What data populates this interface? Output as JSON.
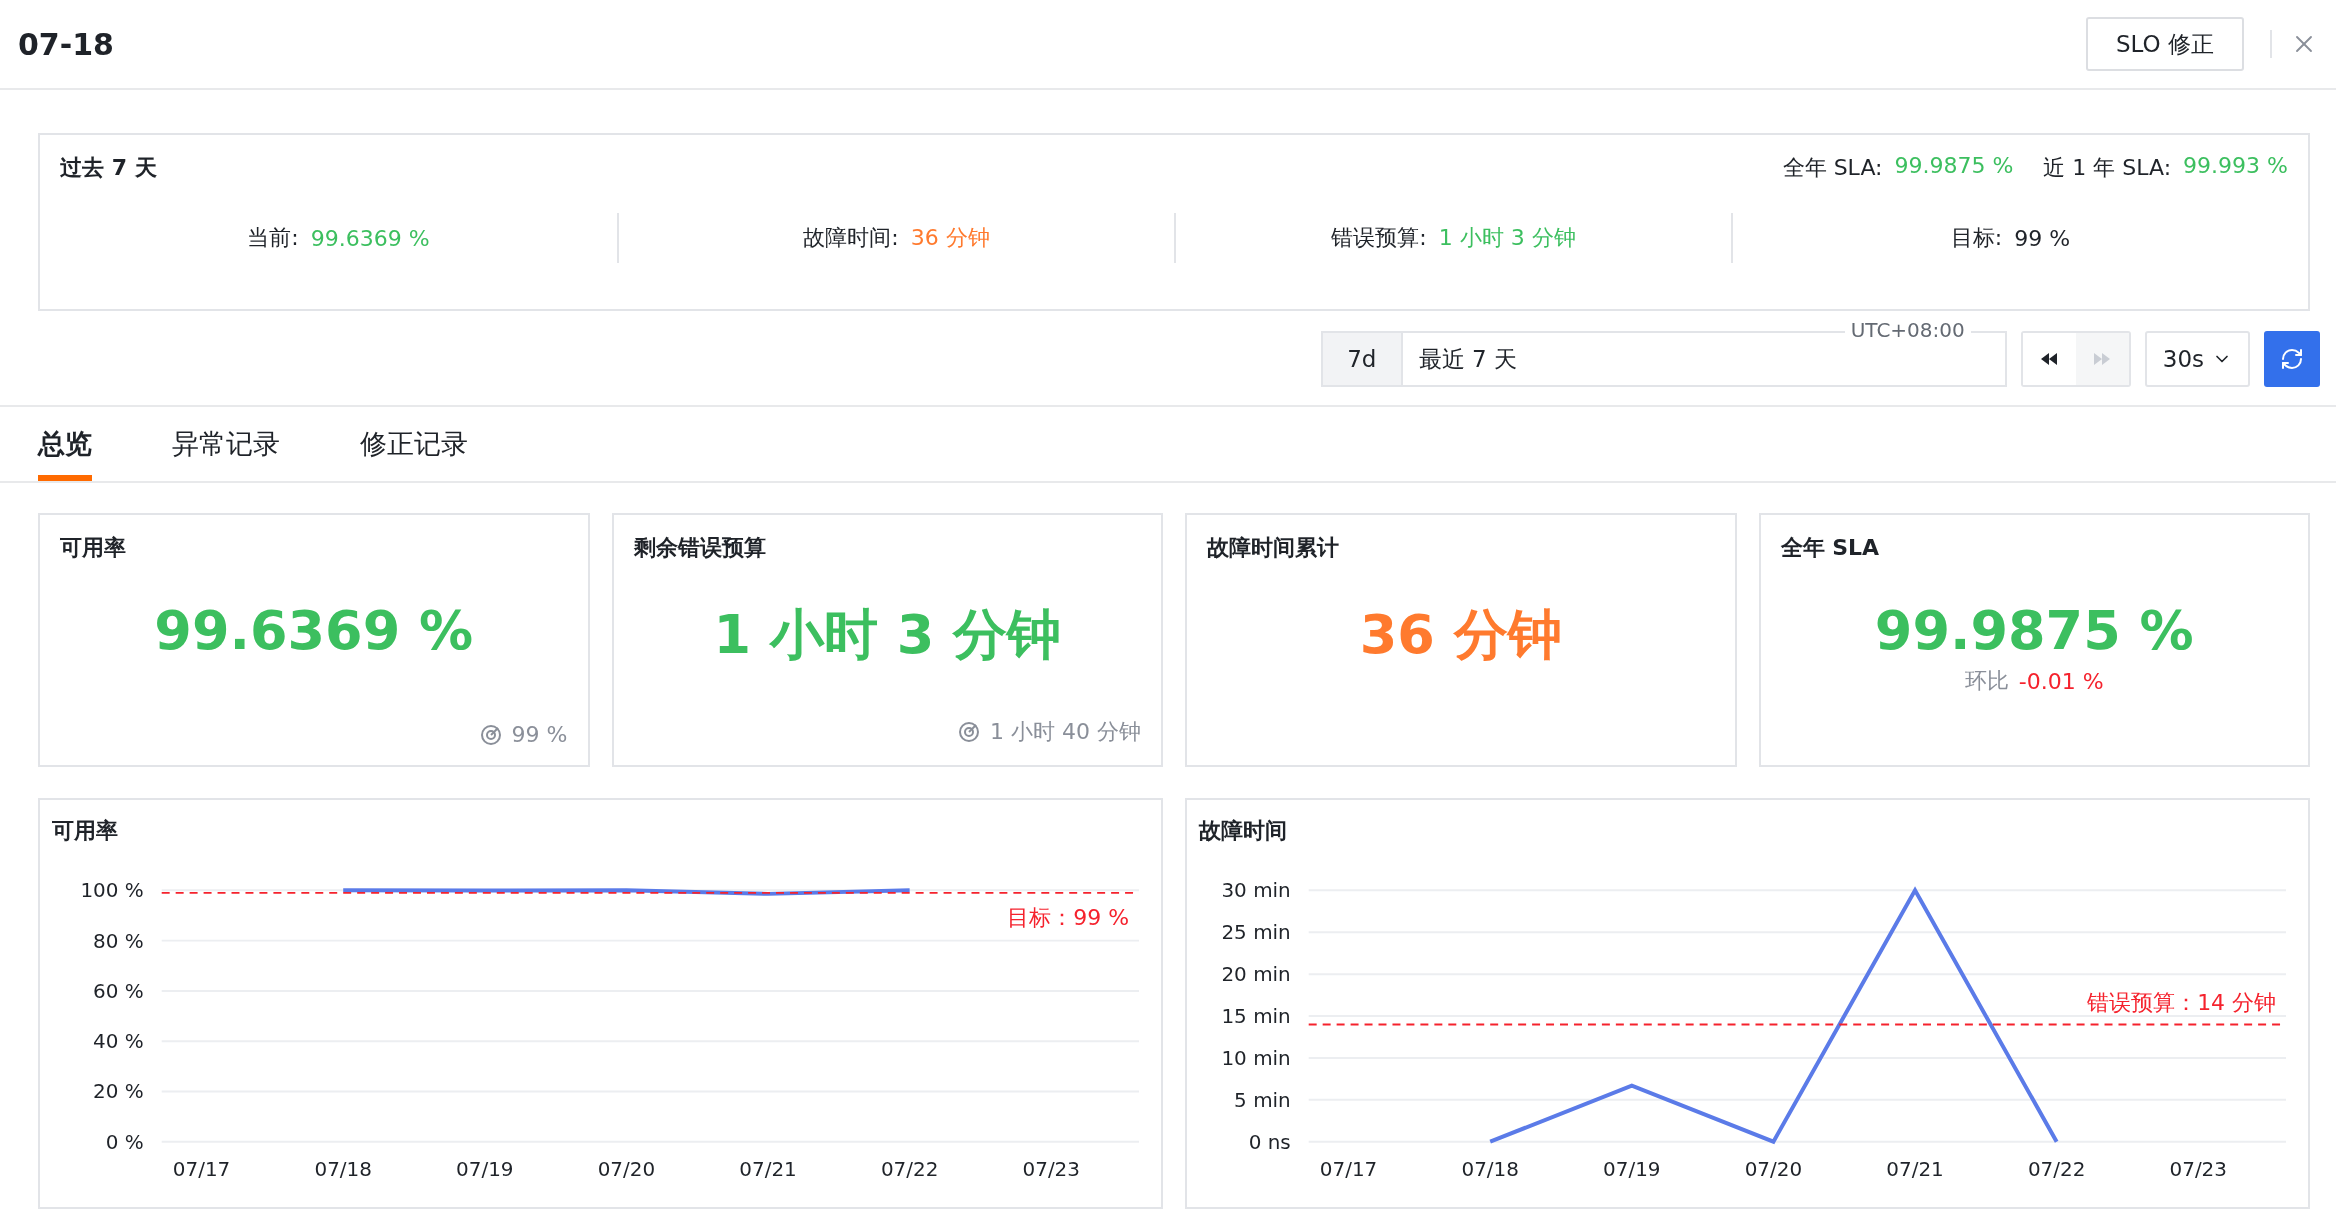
{
  "header": {
    "title": "07-18",
    "action": "SLO 修正"
  },
  "summary": {
    "title": "过去 7 天",
    "sla": [
      {
        "label": "全年 SLA:",
        "value": "99.9875 %",
        "color": "#3cbf5f"
      },
      {
        "label": "近 1 年 SLA:",
        "value": "99.993 %",
        "color": "#3cbf5f"
      }
    ],
    "stats": [
      {
        "label": "当前:",
        "value": "99.6369 %",
        "color": "#3cbf5f"
      },
      {
        "label": "故障时间:",
        "value": "36 分钟",
        "color": "#ff7a2e"
      },
      {
        "label": "错误预算:",
        "value": "1 小时 3 分钟",
        "color": "#3cbf5f"
      },
      {
        "label": "目标:",
        "value": "99 %",
        "color": "#1f2329"
      }
    ]
  },
  "time": {
    "range_unit": "7d",
    "range_text": "最近 7 天",
    "timezone": "UTC+08:00",
    "refresh_interval": "30s",
    "nav_buttons": [
      {
        "kind": "rewind",
        "disabled": false
      },
      {
        "kind": "forward",
        "disabled": true
      }
    ]
  },
  "tabs": [
    {
      "label": "总览",
      "selected": true
    },
    {
      "label": "异常记录",
      "selected": false
    },
    {
      "label": "修正记录",
      "selected": false
    }
  ],
  "cards": [
    {
      "kind": "target",
      "title": "可用率",
      "value": "99.6369 %",
      "color": "#3cbf5f",
      "note": "99 %"
    },
    {
      "kind": "target",
      "title": "剩余错误预算",
      "value": "1 小时 3 分钟",
      "color": "#3cbf5f",
      "note": "1 小时 40 分钟"
    },
    {
      "kind": "plain",
      "title": "故障时间累计",
      "value": "36 分钟",
      "color": "#ff7a2e"
    },
    {
      "kind": "compare",
      "title": "全年 SLA",
      "value": "99.9875 %",
      "color": "#3cbf5f",
      "note_label": "环比",
      "note": "-0.01 %"
    }
  ],
  "charts": [
    {
      "title": "可用率",
      "chart_data": {
        "type": "line",
        "categories": [
          "07/17",
          "07/18",
          "07/19",
          "07/20",
          "07/21",
          "07/22",
          "07/23"
        ],
        "series": [
          {
            "color": "#5b7be8",
            "values": [
              null,
              100,
              99.9,
              100,
              98.6,
              100,
              null
            ]
          }
        ],
        "grid": true,
        "ylim": [
          0,
          100
        ],
        "yticks": [
          {
            "value": 0,
            "label": "0 %"
          },
          {
            "value": 20,
            "label": "20 %"
          },
          {
            "value": 40,
            "label": "40 %"
          },
          {
            "value": 60,
            "label": "60 %"
          },
          {
            "value": 80,
            "label": "80 %"
          },
          {
            "value": 100,
            "label": "100 %"
          }
        ],
        "ref_lines": [
          {
            "axis": "y",
            "value": 99,
            "label": "目标：99 %"
          }
        ]
      }
    },
    {
      "title": "故障时间",
      "chart_data": {
        "type": "line",
        "categories": [
          "07/17",
          "07/18",
          "07/19",
          "07/20",
          "07/21",
          "07/22",
          "07/23"
        ],
        "series": [
          {
            "color": "#5b7be8",
            "values": [
              null,
              0,
              6.7,
              0,
              30,
              0,
              null
            ]
          }
        ],
        "grid": true,
        "ylim": [
          0,
          30
        ],
        "yticks": [
          {
            "value": 0,
            "label": "0 ns"
          },
          {
            "value": 5,
            "label": "5 min"
          },
          {
            "value": 10,
            "label": "10 min"
          },
          {
            "value": 15,
            "label": "15 min"
          },
          {
            "value": 20,
            "label": "20 min"
          },
          {
            "value": 25,
            "label": "25 min"
          },
          {
            "value": 30,
            "label": "30 min"
          }
        ],
        "ref_lines": [
          {
            "axis": "y",
            "value": 14,
            "label": "错误预算：14 分钟"
          }
        ]
      }
    }
  ]
}
